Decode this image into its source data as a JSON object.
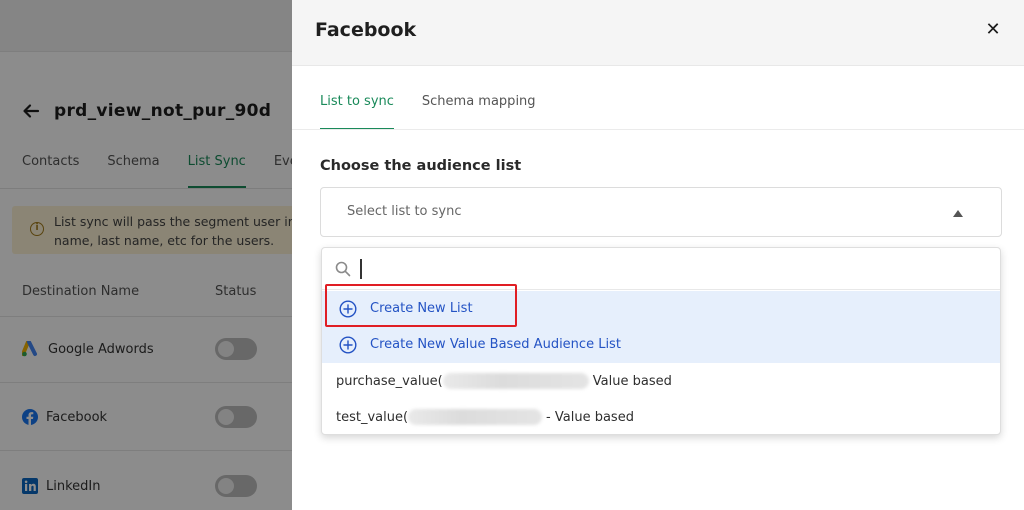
{
  "background_page": {
    "title": "prd_view_not_pur_90d",
    "tabs": [
      {
        "label": "Contacts",
        "active": false
      },
      {
        "label": "Schema",
        "active": false
      },
      {
        "label": "List Sync",
        "active": true
      },
      {
        "label": "Eve",
        "active": false
      }
    ],
    "alert": {
      "line1": "List sync will pass the segment user ir",
      "line2": "name, last name, etc for the users."
    },
    "table": {
      "headers": [
        "Destination Name",
        "Status"
      ],
      "rows": [
        {
          "name": "Google Adwords",
          "icon": "google-ads-icon",
          "toggle_on": false
        },
        {
          "name": "Facebook",
          "icon": "facebook-icon",
          "toggle_on": false
        },
        {
          "name": "LinkedIn",
          "icon": "linkedin-icon",
          "toggle_on": false
        }
      ]
    }
  },
  "drawer": {
    "title": "Facebook",
    "close_icon": "close-icon",
    "tabs": [
      {
        "label": "List to sync",
        "active": true
      },
      {
        "label": "Schema mapping",
        "active": false
      }
    ],
    "section_label": "Choose the audience list",
    "select": {
      "placeholder": "Select list to sync"
    },
    "dropdown": {
      "search_value": "",
      "create_options": [
        {
          "label": "Create New List"
        },
        {
          "label": "Create New Value Based Audience List"
        }
      ],
      "list_options": [
        {
          "prefix": "purchase_value(",
          "suffix": "Value based"
        },
        {
          "prefix": "test_value(",
          "suffix": "- Value based"
        }
      ]
    }
  },
  "colors": {
    "accent_green": "#1a8a5a",
    "link_blue": "#2453c4",
    "highlight_red": "#e01e24",
    "option_bg": "#e6effc"
  }
}
